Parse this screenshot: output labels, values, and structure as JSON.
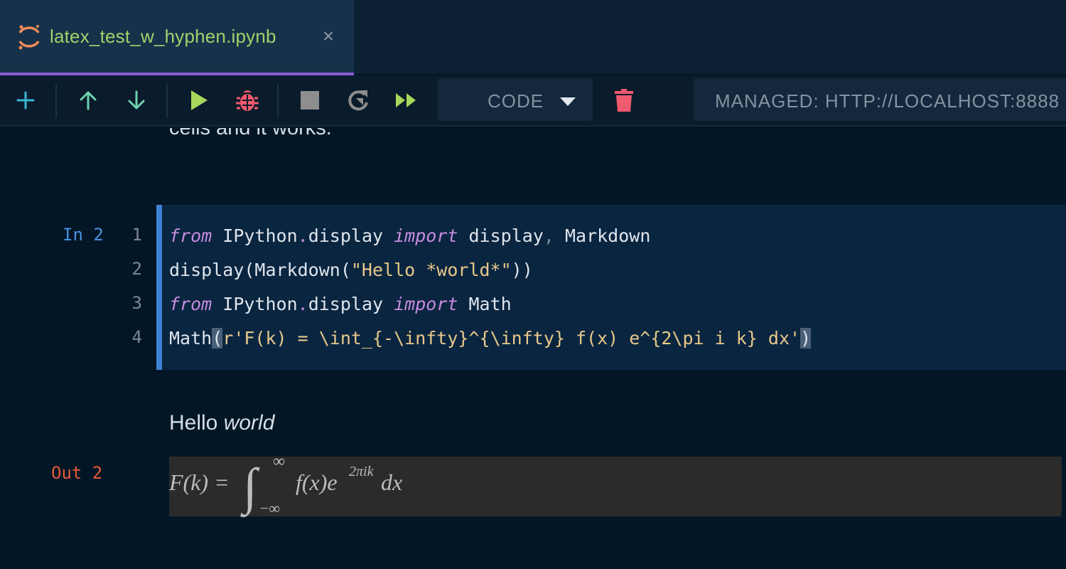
{
  "tab": {
    "title": "latex_test_w_hyphen.ipynb",
    "close_glyph": "×",
    "icon": "jupyter-logo-icon"
  },
  "toolbar": {
    "buttons": [
      "add-cell-icon",
      "move-up-icon",
      "move-down-icon",
      "run-icon",
      "debug-icon",
      "stop-icon",
      "restart-icon",
      "run-all-icon",
      "trash-icon"
    ],
    "cell_kind": "CODE",
    "kernel": "MANAGED: HTTP://LOCALHOST:8888"
  },
  "previous_cell_text": "cells and it works.",
  "code_cell": {
    "prompt": "In 2",
    "line_numbers": [
      "1",
      "2",
      "3",
      "4"
    ],
    "lines": [
      "from IPython.display import display, Markdown",
      "display(Markdown(\"Hello *world*\"))",
      "from IPython.display import Math",
      "Math(r'F(k) = \\int_{-\\infty}^{\\infty} f(x) e^{2\\pi i k} dx')"
    ]
  },
  "output": {
    "prompt": "Out 2",
    "markdown_plain": "Hello ",
    "markdown_italic": "world",
    "math": {
      "lhs": "F(k) =",
      "integral": "∫",
      "upper": "∞",
      "lower": "−∞",
      "body": "f(x)e",
      "exponent": "2πik",
      "tail": "dx"
    }
  },
  "colors": {
    "accent_purple": "#8a5cd1",
    "cell_border": "#3d82d4",
    "prompt_in": "#4a90e2",
    "prompt_out": "#e05a38",
    "run_green": "#a6d65a",
    "debug_red": "#f05a6e"
  }
}
